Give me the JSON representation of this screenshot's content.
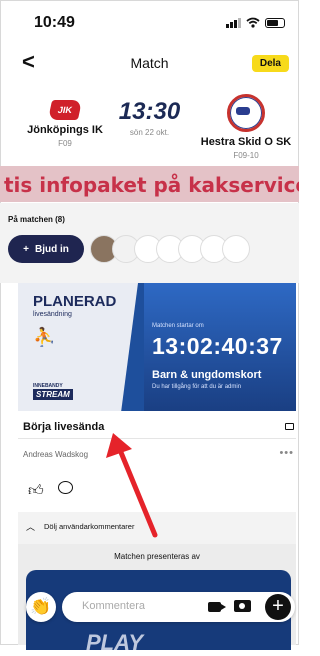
{
  "status": {
    "time": "10:49"
  },
  "nav": {
    "back_label": "<",
    "title": "Match",
    "share_label": "Dela"
  },
  "match": {
    "home": {
      "name": "Jönköpings IK",
      "class": "F09",
      "logo_text": "JIK"
    },
    "away": {
      "name": "Hestra Skid O SK",
      "class": "F09-10"
    },
    "kickoff_time": "13:30",
    "kickoff_date": "sön 22 okt."
  },
  "ad": {
    "text": "tis infopaket på kakservice"
  },
  "participants": {
    "title": "På matchen (8)",
    "invite_label": "Bjud in"
  },
  "stream": {
    "planned": "PLANERAD",
    "planned_sub": "livesändning",
    "brand_small": "INNEBANDY",
    "brand": "STREAM",
    "starts_label": "Matchen startar om",
    "countdown": "13:02:40:37",
    "youth_card": "Barn & ungdomskort",
    "access_note": "Du har tillgång för att du är admin"
  },
  "golive": {
    "label": "Börja livesända"
  },
  "author": {
    "name": "Andreas Wadskog",
    "more": "•••"
  },
  "comments_toggle": {
    "label": "Dölj användarkommentarer"
  },
  "presented": {
    "label": "Matchen presenteras av"
  },
  "comment_bar": {
    "placeholder": "Kommentera"
  },
  "icons": [
    "back-icon",
    "signal-icon",
    "wifi-icon",
    "battery-icon",
    "invite-plus-icon",
    "hockey-player-icon",
    "camera-icon",
    "more-icon",
    "thumbs-up-icon",
    "comment-icon",
    "chevron-up-icon",
    "clap-icon",
    "video-icon",
    "photo-icon",
    "add-icon"
  ],
  "colors": {
    "share_yellow": "#f7da1b",
    "invite_navy": "#1f2550",
    "stream_blue": "#1e4f9c",
    "ad_red": "#c73149",
    "arrow_red": "#e5232a"
  }
}
